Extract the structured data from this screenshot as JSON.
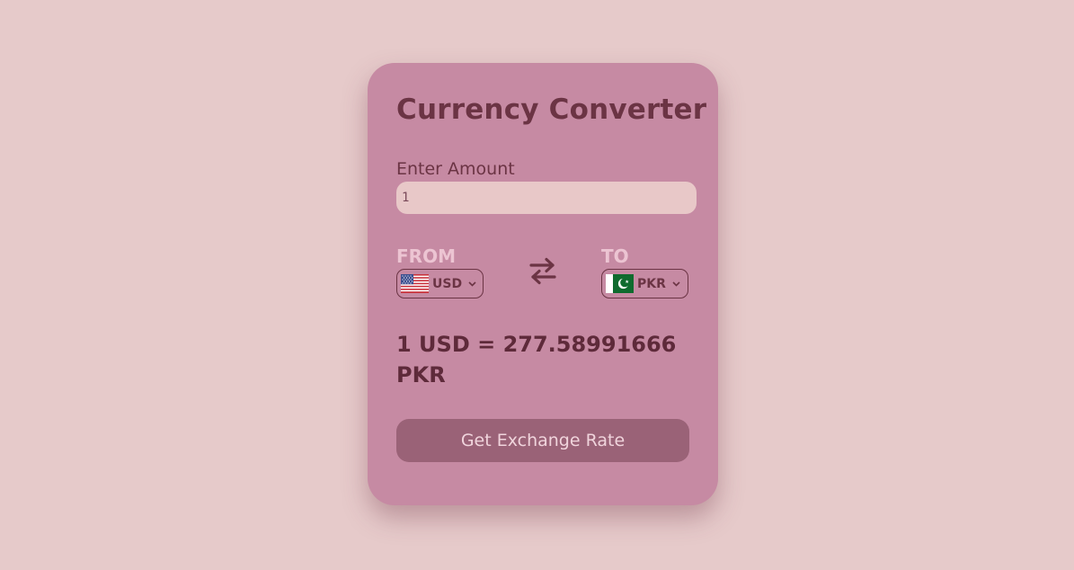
{
  "converter": {
    "title": "Currency Converter",
    "amount_label": "Enter Amount",
    "amount_value": "1",
    "from_label": "FROM",
    "to_label": "TO",
    "from_currency": "USD",
    "to_currency": "PKR",
    "result_text": "1 USD = 277.58991666 PKR",
    "button_label": "Get Exchange Rate"
  },
  "icons": {
    "from_flag": "us-flag-icon",
    "to_flag": "pk-flag-icon",
    "swap": "swap-arrows-icon",
    "dropdown": "chevron-down-icon"
  },
  "colors": {
    "page_background": "#e6caca",
    "card_background": "#c68aa3",
    "title_text": "#6b3444",
    "label_accent": "#ecc4d2",
    "input_background": "#e8c8c8",
    "button_background": "#9a6277",
    "button_text": "#f0d4dc"
  }
}
